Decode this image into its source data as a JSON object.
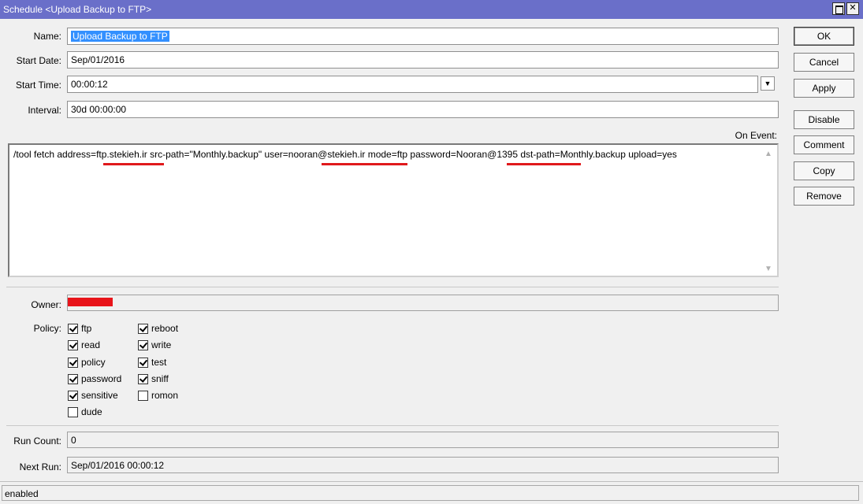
{
  "window": {
    "title": "Schedule <Upload Backup to FTP>"
  },
  "form": {
    "name_label": "Name:",
    "name_value": "Upload Backup to FTP",
    "start_date_label": "Start Date:",
    "start_date_value": "Sep/01/2016",
    "start_time_label": "Start Time:",
    "start_time_value": "00:00:12",
    "interval_label": "Interval:",
    "interval_value": "30d 00:00:00",
    "on_event_label": "On Event:",
    "on_event_value": "/tool fetch address=ftp.stekieh.ir src-path=\"Monthly.backup\" user=nooran@stekieh.ir mode=ftp password=Nooran@1395 dst-path=Monthly.backup upload=yes",
    "owner_label": "Owner:",
    "policy_label": "Policy:",
    "run_count_label": "Run Count:",
    "run_count_value": "0",
    "next_run_label": "Next Run:",
    "next_run_value": "Sep/01/2016 00:00:12"
  },
  "policies": [
    {
      "label": "ftp",
      "checked": true
    },
    {
      "label": "reboot",
      "checked": true
    },
    {
      "label": "read",
      "checked": true
    },
    {
      "label": "write",
      "checked": true
    },
    {
      "label": "policy",
      "checked": true
    },
    {
      "label": "test",
      "checked": true
    },
    {
      "label": "password",
      "checked": true
    },
    {
      "label": "sniff",
      "checked": true
    },
    {
      "label": "sensitive",
      "checked": true
    },
    {
      "label": "romon",
      "checked": false
    },
    {
      "label": "dude",
      "checked": false
    }
  ],
  "buttons": {
    "ok": "OK",
    "cancel": "Cancel",
    "apply": "Apply",
    "disable": "Disable",
    "comment": "Comment",
    "copy": "Copy",
    "remove": "Remove"
  },
  "status": {
    "text": "enabled"
  },
  "colors": {
    "titlebar": "#6a6fc9",
    "annotation_red": "#e0191c",
    "selection": "#3390ff"
  },
  "icons": {
    "window_maximize": "maximize-icon",
    "window_close": "close-icon",
    "dropdown": "dropdown-arrow-icon"
  }
}
